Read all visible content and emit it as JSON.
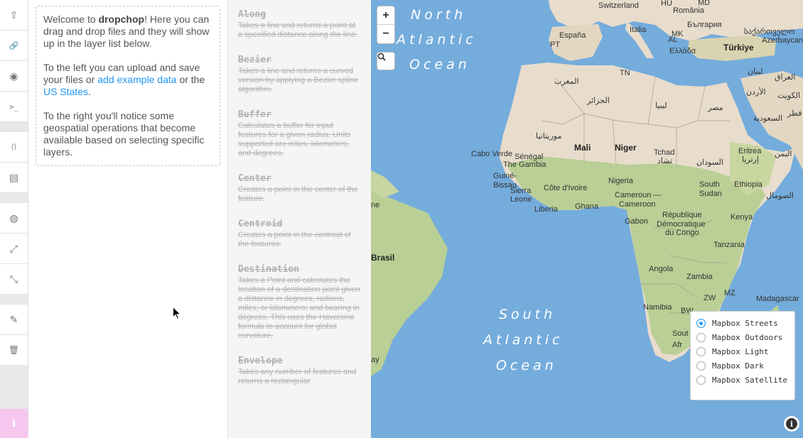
{
  "toolbar": {
    "buttons": [
      {
        "icon": "upload-icon",
        "glyph": "⇧"
      },
      {
        "icon": "link-icon",
        "glyph": "🔗"
      },
      {
        "icon": "github-icon",
        "glyph": "◉"
      },
      {
        "icon": "terminal-icon",
        "glyph": ">_"
      },
      {
        "icon": "code-file-icon",
        "glyph": "⟨⟩"
      },
      {
        "icon": "file-icon",
        "glyph": "▤"
      },
      {
        "icon": "globe-icon",
        "glyph": "◍"
      },
      {
        "icon": "expand-icon",
        "glyph": "⤢"
      },
      {
        "icon": "collapse-icon",
        "glyph": "⤡"
      },
      {
        "icon": "pencil-icon",
        "glyph": "✎"
      },
      {
        "icon": "trash-icon",
        "glyph": "🗑"
      }
    ],
    "info_glyph": "i"
  },
  "welcome": {
    "p1_prefix": "Welcome to ",
    "p1_brand": "dropchop",
    "p1_suffix": "! Here you can drag and drop files and they will show up in the layer list below.",
    "p2_prefix": "To the left you can upload and save your files or ",
    "p2_link1": "add example data",
    "p2_mid": " or the ",
    "p2_link2": "US States",
    "p2_suffix": ".",
    "p3": "To the right you'll notice some geospatial operations that become available based on selecting specific layers."
  },
  "operations": [
    {
      "title": "Along",
      "desc": "Takes a line and returns a point at a specified distance along the line."
    },
    {
      "title": "Bezier",
      "desc": "Takes a line and returns a curved version by applying a Bezier spline algorithm."
    },
    {
      "title": "Buffer",
      "desc": "Calculates a buffer for input features for a given radius. Units supported are miles, kilometers, and degrees."
    },
    {
      "title": "Center",
      "desc": "Creates a point in the center of the feature."
    },
    {
      "title": "Centroid",
      "desc": "Creates a point in the centroid of the features."
    },
    {
      "title": "Destination",
      "desc": "Takes a Point and calculates the location of a destination point given a distance in degrees, radians, miles, or kilometers; and bearing in degrees. This uses the Haversine formula to account for global curvature."
    },
    {
      "title": "Envelope",
      "desc": "Takes any number of features and returns a rectangular"
    }
  ],
  "map": {
    "zoom_in": "+",
    "zoom_out": "−",
    "ocean_north": [
      "North",
      "Atlantic",
      "Ocean"
    ],
    "ocean_south": [
      "South",
      "Atlantic",
      "Ocean"
    ],
    "labels": {
      "switzerland": "Switzerland",
      "hu": "HU",
      "romania": "România",
      "md": "MD",
      "espana": "España",
      "italia": "Italia",
      "pt": "PT",
      "mk": "MK",
      "al": "AL",
      "bulgaria": "България",
      "georgia": "საქართველო",
      "ellada": "Ελλάδα",
      "turkiye": "Türkiye",
      "azerbaycan": "Azerbaycan",
      "tn": "TN",
      "maghrib": "المغرب",
      "lubnan": "لبنان",
      "jazair": "الجزائر",
      "iraq": "العراق",
      "urdun": "الأردن",
      "kuwait": "الكويت",
      "libya": "ليبيا",
      "misr": "مصر",
      "saudi": "السعودية",
      "qatar": "قطر",
      "mauritania": "موريتانيا",
      "mali": "Mali",
      "niger": "Niger",
      "tchad": "Tchad",
      "tchad_ar": "تشاد",
      "sudan_ar": "السودان",
      "eritrea": "Eritrea",
      "eritrea_ar": "إرتريا",
      "yemen": "اليمن",
      "cabo_verde": "Cabo Verde",
      "senegal": "Sénégal",
      "gambia": "The Gambia",
      "guinee": "Guiné-",
      "bissau": "Bissau",
      "sierra": "Sierra",
      "leone": "Leone",
      "cote": "Côte d'Ivoire",
      "liberia": "Liberia",
      "ghana": "Ghana",
      "nigeria": "Nigeria",
      "cameroun": "Cameroun —",
      "cameroon": "Cameroon",
      "south_sudan_1": "South",
      "south_sudan_2": "Sudan",
      "ethiopia": "Ethiopia",
      "somalia": "الصومال",
      "gabon": "Gabon",
      "rep": "République",
      "dem": "Démocratique",
      "congo": "du Congo",
      "kenya": "Kenya",
      "tanzania": "Tanzania",
      "angola": "Angola",
      "zambia": "Zambia",
      "zw": "ZW",
      "mz": "MZ",
      "madagascar": "Madagascar",
      "namibia": "Namibia",
      "bw": "BW",
      "sout": "Sout",
      "afr": "Afr",
      "brasil": "Brasil",
      "ne": "ne",
      "ay": "ay"
    },
    "basemaps": [
      {
        "label": "Mapbox Streets",
        "selected": true
      },
      {
        "label": "Mapbox Outdoors",
        "selected": false
      },
      {
        "label": "Mapbox Light",
        "selected": false
      },
      {
        "label": "Mapbox Dark",
        "selected": false
      },
      {
        "label": "Mapbox Satellite",
        "selected": false
      }
    ],
    "info_glyph": "i"
  },
  "colors": {
    "ocean": "#74acdc",
    "land": "#e8dccc",
    "vegetation": "#b9cf95",
    "accent": "#2196f3",
    "info_button": "#f7c6ef"
  }
}
